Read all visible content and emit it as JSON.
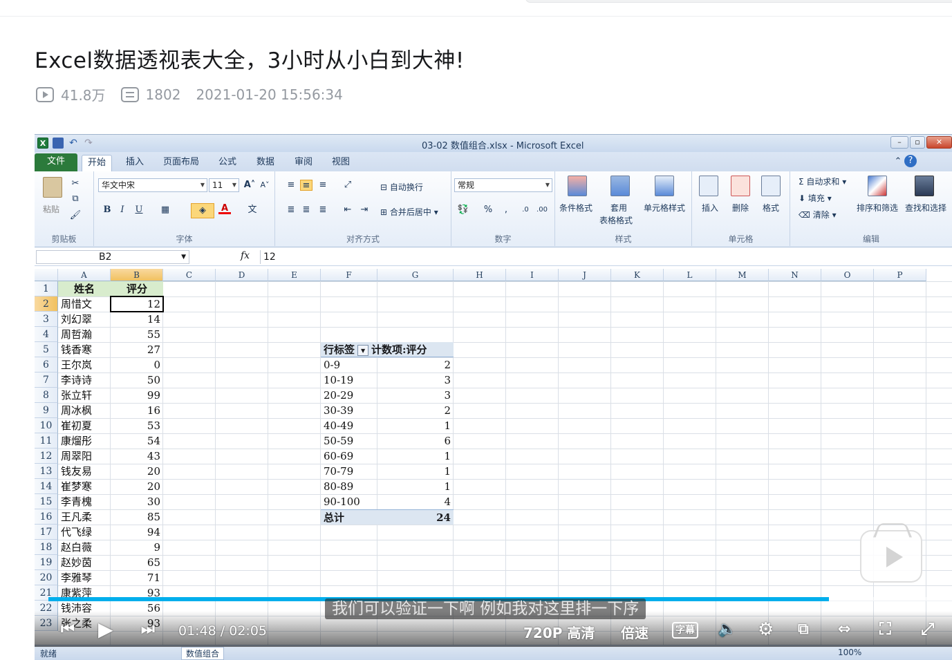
{
  "page": {
    "video_title": "Excel数据透视表大全，3小时从小白到大神!",
    "views": "41.8万",
    "danmaku": "1802",
    "publish_time": "2021-01-20 15:56:34"
  },
  "excel": {
    "window_title": "03-02 数值组合.xlsx  -  Microsoft Excel",
    "tabs": [
      "文件",
      "开始",
      "插入",
      "页面布局",
      "公式",
      "数据",
      "审阅",
      "视图"
    ],
    "active_tab": "开始",
    "ribbon": {
      "clipboard": {
        "paste": "粘贴",
        "label": "剪贴板"
      },
      "font": {
        "name": "华文中宋",
        "size": "11",
        "label": "字体",
        "bold": "B",
        "italic": "I",
        "underline": "U"
      },
      "alignment": {
        "wrap": "自动换行",
        "merge": "合并后居中",
        "label": "对齐方式"
      },
      "number": {
        "format": "常规",
        "percent": "%",
        "comma": ",",
        "label": "数字"
      },
      "styles": {
        "cond": "条件格式",
        "table": "套用",
        "table2": "表格格式",
        "cell": "单元格样式",
        "label": "样式"
      },
      "cells": {
        "insert": "插入",
        "delete": "删除",
        "format": "格式",
        "label": "单元格"
      },
      "editing": {
        "autosum": "自动求和",
        "fill": "填充",
        "clear": "清除",
        "sort": "排序和筛选",
        "find": "查找和选择",
        "label": "编辑"
      }
    },
    "name_box": "B2",
    "fx": "fx",
    "formula_value": "12",
    "columns": [
      "A",
      "B",
      "C",
      "D",
      "E",
      "F",
      "G",
      "H",
      "I",
      "J",
      "K",
      "L",
      "M",
      "N",
      "O",
      "P"
    ],
    "rows": [
      {
        "n": "1",
        "a": "姓名",
        "b": "评分"
      },
      {
        "n": "2",
        "a": "周惜文",
        "b": "12"
      },
      {
        "n": "3",
        "a": "刘幻翠",
        "b": "14"
      },
      {
        "n": "4",
        "a": "周哲瀚",
        "b": "55"
      },
      {
        "n": "5",
        "a": "钱香寒",
        "b": "27"
      },
      {
        "n": "6",
        "a": "王尔岚",
        "b": "0"
      },
      {
        "n": "7",
        "a": "李诗诗",
        "b": "50"
      },
      {
        "n": "8",
        "a": "张立轩",
        "b": "99"
      },
      {
        "n": "9",
        "a": "周冰枫",
        "b": "16"
      },
      {
        "n": "10",
        "a": "崔初夏",
        "b": "53"
      },
      {
        "n": "11",
        "a": "康熘彤",
        "b": "54"
      },
      {
        "n": "12",
        "a": "周翠阳",
        "b": "43"
      },
      {
        "n": "13",
        "a": "钱友易",
        "b": "20"
      },
      {
        "n": "14",
        "a": "崔梦寒",
        "b": "20"
      },
      {
        "n": "15",
        "a": "李青槐",
        "b": "30"
      },
      {
        "n": "16",
        "a": "王凡柔",
        "b": "85"
      },
      {
        "n": "17",
        "a": "代飞绿",
        "b": "94"
      },
      {
        "n": "18",
        "a": "赵白薇",
        "b": "9"
      },
      {
        "n": "19",
        "a": "赵妙茵",
        "b": "65"
      },
      {
        "n": "20",
        "a": "李雅琴",
        "b": "71"
      },
      {
        "n": "21",
        "a": "康紫萍",
        "b": "93"
      },
      {
        "n": "22",
        "a": "钱沛容",
        "b": "56"
      },
      {
        "n": "23",
        "a": "张之柔",
        "b": "93"
      }
    ],
    "pivot": {
      "row_label": "行标签",
      "value_label": "计数项:评分",
      "items": [
        {
          "label": "0-9",
          "count": "2"
        },
        {
          "label": "10-19",
          "count": "3"
        },
        {
          "label": "20-29",
          "count": "3"
        },
        {
          "label": "30-39",
          "count": "2"
        },
        {
          "label": "40-49",
          "count": "1"
        },
        {
          "label": "50-59",
          "count": "6"
        },
        {
          "label": "60-69",
          "count": "1"
        },
        {
          "label": "70-79",
          "count": "1"
        },
        {
          "label": "80-89",
          "count": "1"
        },
        {
          "label": "90-100",
          "count": "4"
        }
      ],
      "total_label": "总计",
      "total": "24"
    },
    "sheet_tab": "数值组合",
    "status_ready": "就绪",
    "zoom": "100%"
  },
  "player": {
    "subtitle": "我们可以验证一下啊  例如我对这里排一下序",
    "current_time": "01:48",
    "duration": "02:05",
    "progress": 0.864,
    "quality": "720P 高清",
    "speed": "倍速",
    "caption_btn": "字幕",
    "accent_color": "#00aeec"
  }
}
